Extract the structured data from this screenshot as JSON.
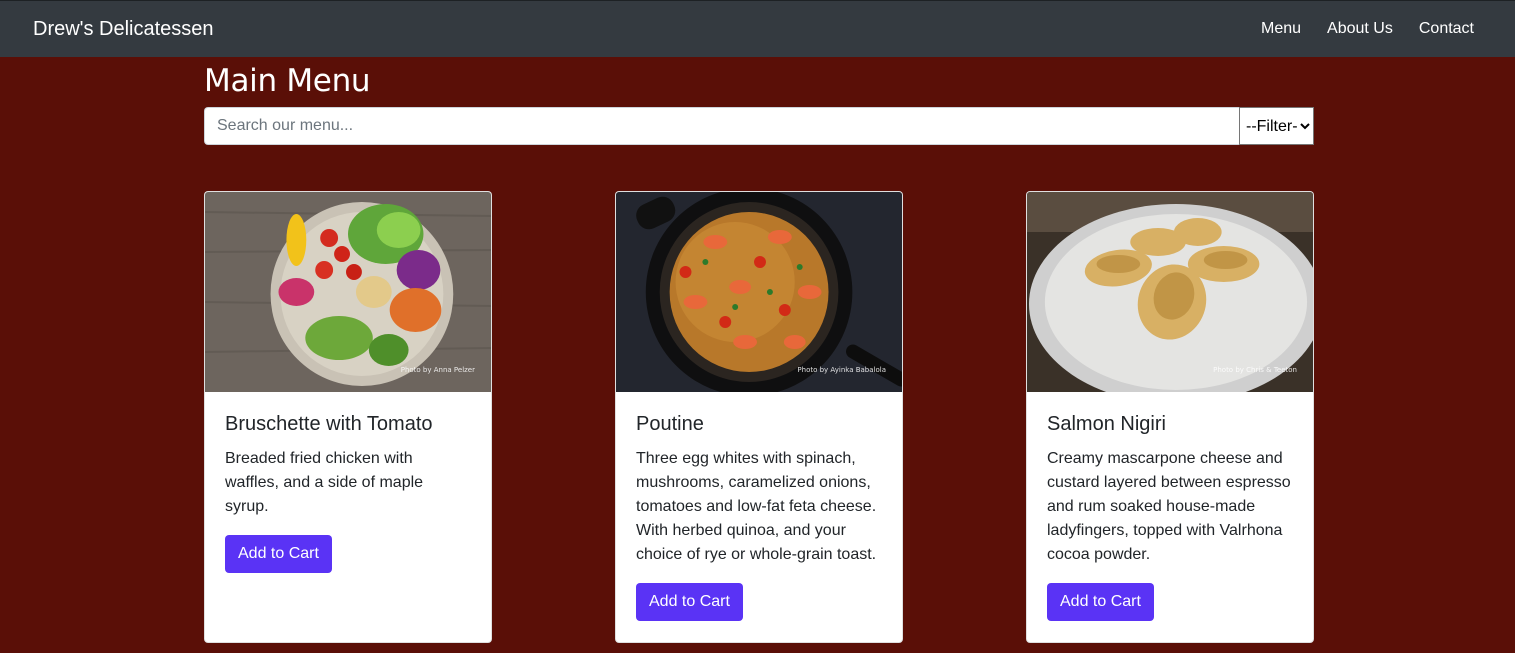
{
  "navbar": {
    "brand": "Drew's Delicatessen",
    "links": [
      "Menu",
      "About Us",
      "Contact"
    ]
  },
  "main": {
    "title": "Main Menu",
    "search": {
      "placeholder": "Search our menu...",
      "value": ""
    },
    "filter": {
      "selected": "--Filter--"
    }
  },
  "cards": [
    {
      "title": "Bruschette with Tomato",
      "description": "Breaded fried chicken with waffles, and a side of maple syrup.",
      "button": "Add to Cart",
      "photo_credit": "Photo by Anna Pelzer"
    },
    {
      "title": "Poutine",
      "description": "Three egg whites with spinach, mushrooms, caramelized onions, tomatoes and low-fat feta cheese. With herbed quinoa, and your choice of rye or whole-grain toast.",
      "button": "Add to Cart",
      "photo_credit": "Photo by Ayinka Babalola"
    },
    {
      "title": "Salmon Nigiri",
      "description": "Creamy mascarpone cheese and custard layered between espresso and rum soaked house-made ladyfingers, topped with Valrhona cocoa powder.",
      "button": "Add to Cart",
      "photo_credit": "Photo by Chris & Teeton"
    }
  ],
  "colors": {
    "background": "#5a0f07",
    "navbar": "#343a40",
    "button": "#5a33f5"
  }
}
